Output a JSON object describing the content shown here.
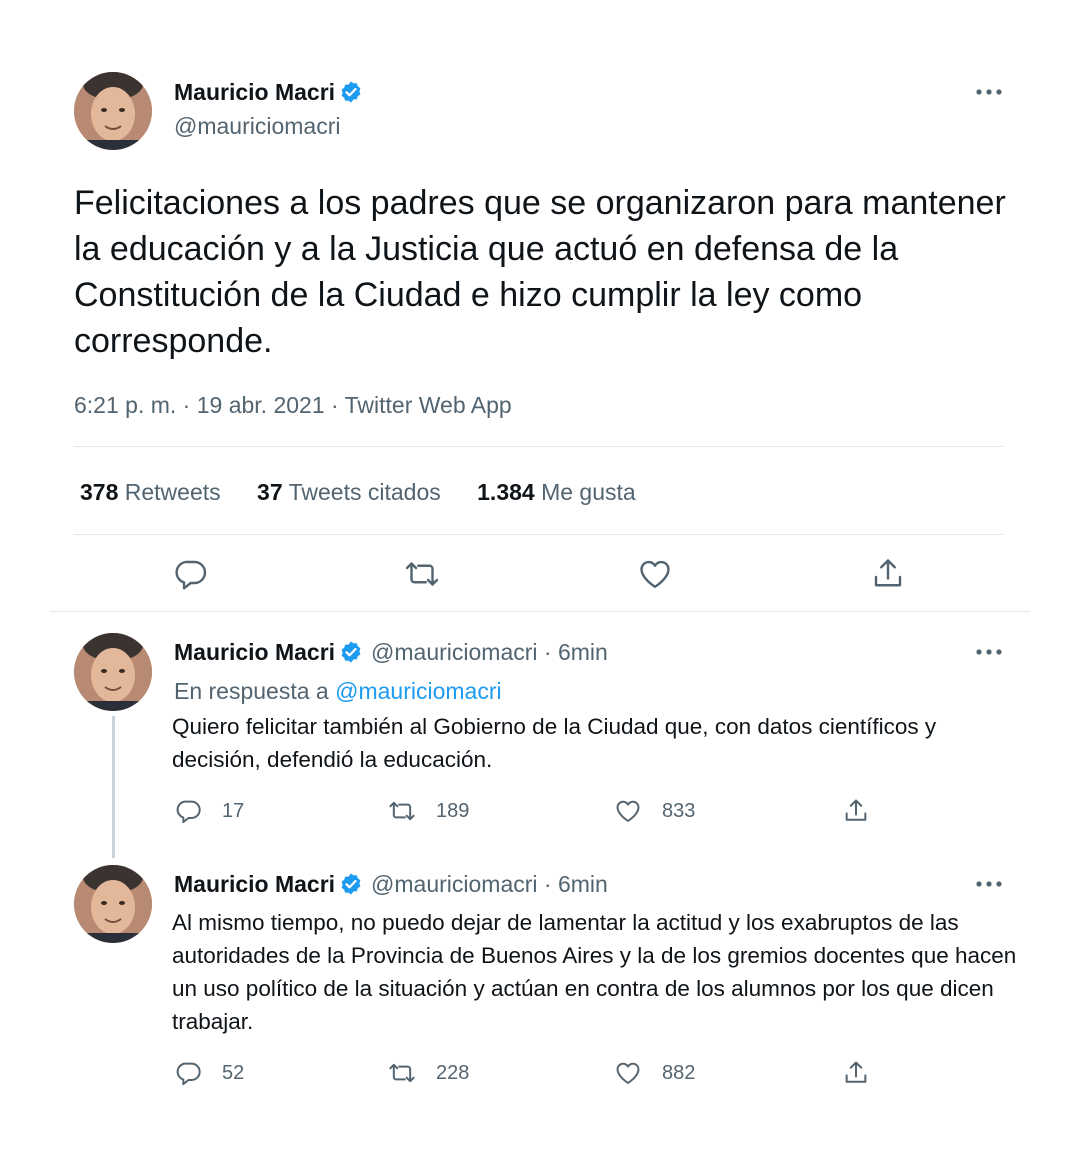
{
  "main_tweet": {
    "author_name": "Mauricio Macri",
    "handle": "@mauriciomacri",
    "text": "Felicitaciones a los padres que se organizaron para mantener la educación y a la Justicia que actuó en defensa de la Constitución de la Ciudad e hizo cumplir la ley como corresponde.",
    "meta": "6:21 p. m. · 19 abr. 2021 · Twitter Web App",
    "stats": [
      {
        "count": "378",
        "label": "Retweets"
      },
      {
        "count": "37",
        "label": "Tweets citados"
      },
      {
        "count": "1.384",
        "label": "Me gusta"
      }
    ]
  },
  "replies": [
    {
      "author_name": "Mauricio Macri",
      "handle_time": "@mauriciomacri · 6min",
      "reply_to_prefix": "En respuesta a",
      "reply_to_mention": "@mauriciomacri",
      "text": "Quiero felicitar también al Gobierno de la Ciudad que, con datos científicos y decisión, defendió la educación.",
      "replies_count": "17",
      "retweets_count": "189",
      "likes_count": "833"
    },
    {
      "author_name": "Mauricio Macri",
      "handle_time": "@mauriciomacri · 6min",
      "text": "Al mismo tiempo, no puedo dejar de lamentar la actitud y los exabruptos de las autoridades de la Provincia de Buenos Aires y la de los gremios docentes que hacen un uso político de la situación y actúan en contra de los alumnos por los que dicen trabajar.",
      "replies_count": "52",
      "retweets_count": "228",
      "likes_count": "882"
    }
  ],
  "icons": {
    "verified": "verified-badge-icon",
    "more": "more-dots-icon",
    "reply": "reply-bubble-icon",
    "retweet": "retweet-icon",
    "like": "heart-icon",
    "share": "share-upload-icon"
  },
  "colors": {
    "accent": "#1d9bf0",
    "text_primary": "#0f1419",
    "text_secondary": "#536471",
    "divider": "#e1e8ed"
  }
}
